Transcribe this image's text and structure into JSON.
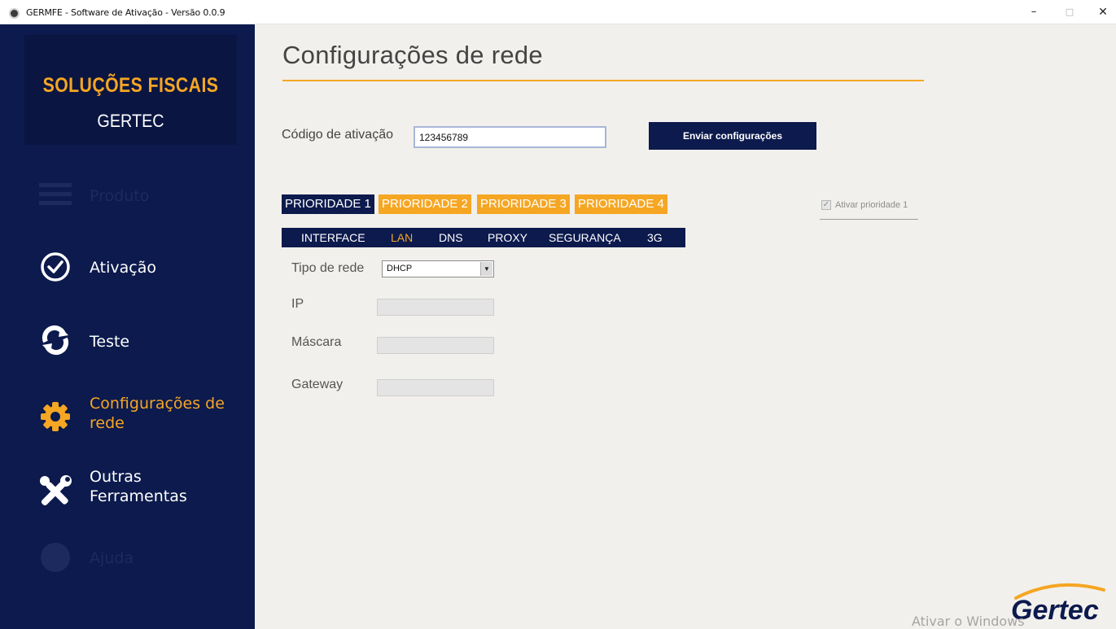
{
  "window": {
    "title": "GERMFE - Software de Ativação - Versão 0.0.9",
    "minimize_label": "–",
    "maximize_label": "□",
    "close_label": "✕"
  },
  "sidebar": {
    "brand_line1": "SOLUÇÕES FISCAIS",
    "brand_line2": "GERTEC",
    "items": [
      {
        "label": "Produto",
        "icon": "menu-icon",
        "state": "disabled"
      },
      {
        "label": "Ativação",
        "icon": "check-circle-icon",
        "state": "normal"
      },
      {
        "label": "Teste",
        "icon": "refresh-icon",
        "state": "normal"
      },
      {
        "label": "Configurações de rede",
        "icon": "gear-icon",
        "state": "active"
      },
      {
        "label": "Outras Ferramentas",
        "icon": "tools-icon",
        "state": "normal"
      },
      {
        "label": "Ajuda",
        "icon": "help-icon",
        "state": "disabled"
      }
    ]
  },
  "main": {
    "page_title": "Configurações de rede",
    "activation_label": "Código de ativação",
    "activation_value": "123456789",
    "send_button": "Enviar configurações",
    "priority_tabs": [
      {
        "label": "PRIORIDADE 1",
        "active": true
      },
      {
        "label": "PRIORIDADE 2",
        "active": false
      },
      {
        "label": "PRIORIDADE 3",
        "active": false
      },
      {
        "label": "PRIORIDADE 4",
        "active": false
      }
    ],
    "priority_checkbox_label": "Ativar prioridade 1",
    "priority_checkbox_checked": true,
    "subtabs": [
      {
        "label": "INTERFACE",
        "active": false
      },
      {
        "label": "LAN",
        "active": true
      },
      {
        "label": "DNS",
        "active": false
      },
      {
        "label": "PROXY",
        "active": false
      },
      {
        "label": "SEGURANÇA",
        "active": false
      },
      {
        "label": "3G",
        "active": false
      }
    ],
    "network_type_label": "Tipo de rede",
    "network_type_value": "DHCP",
    "ip_label": "IP",
    "ip_value": "",
    "mask_label": "Máscara",
    "mask_value": "",
    "gateway_label": "Gateway",
    "gateway_value": ""
  },
  "footer": {
    "logo_text": "Gertec",
    "watermark": "Ativar o Windows"
  },
  "colors": {
    "navy": "#0c1a4d",
    "accent_orange": "#f5a623",
    "background": "#f2f0ec"
  }
}
